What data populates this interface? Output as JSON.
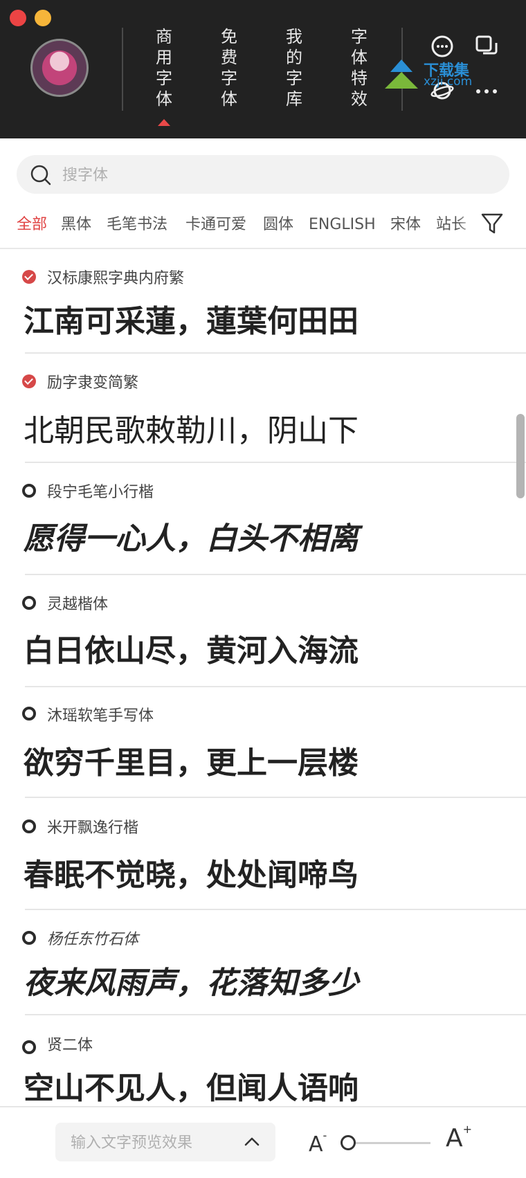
{
  "header": {
    "tabs": [
      {
        "label": "商用字体",
        "active": true
      },
      {
        "label": "免费字体",
        "active": false
      },
      {
        "label": "我的字库",
        "active": false
      },
      {
        "label": "字体特效",
        "active": false
      }
    ],
    "watermark": {
      "line1": "下载集",
      "line2": "xzji.com"
    }
  },
  "search": {
    "placeholder": "搜字体",
    "value": ""
  },
  "categories": [
    "全部",
    "黑体",
    "毛笔书法",
    "卡通可爱",
    "圆体",
    "ENGLISH",
    "宋体",
    "站长"
  ],
  "active_category": "全部",
  "fonts": [
    {
      "name": "汉标康熙字典内府繁",
      "preview": "江南可采蓮，蓮葉何田田",
      "installed": true
    },
    {
      "name": "励字隶变简繁",
      "preview": "北朝民歌敕勒川，阴山下",
      "installed": true
    },
    {
      "name": "段宁毛笔小行楷",
      "preview": "愿得一心人，白头不相离",
      "installed": false
    },
    {
      "name": "灵越楷体",
      "preview": "白日依山尽，黄河入海流",
      "installed": false
    },
    {
      "name": "沐瑶软笔手写体",
      "preview": "欲穷千里目，更上一层楼",
      "installed": false
    },
    {
      "name": "米开飘逸行楷",
      "preview": "春眠不觉晓，处处闻啼鸟",
      "installed": false
    },
    {
      "name": "杨任东竹石体",
      "preview": "夜来风雨声，花落知多少",
      "installed": false
    },
    {
      "name": "贤二体",
      "preview": "空山不见人，但闻人语响",
      "installed": false
    }
  ],
  "bottom": {
    "preview_placeholder": "输入文字预览效果",
    "size_small_label": "A",
    "size_small_sign": "-",
    "size_large_label": "A",
    "size_large_sign": "+",
    "font_size_level": 0
  },
  "colors": {
    "accent": "#e04444",
    "header_bg": "#222222"
  }
}
